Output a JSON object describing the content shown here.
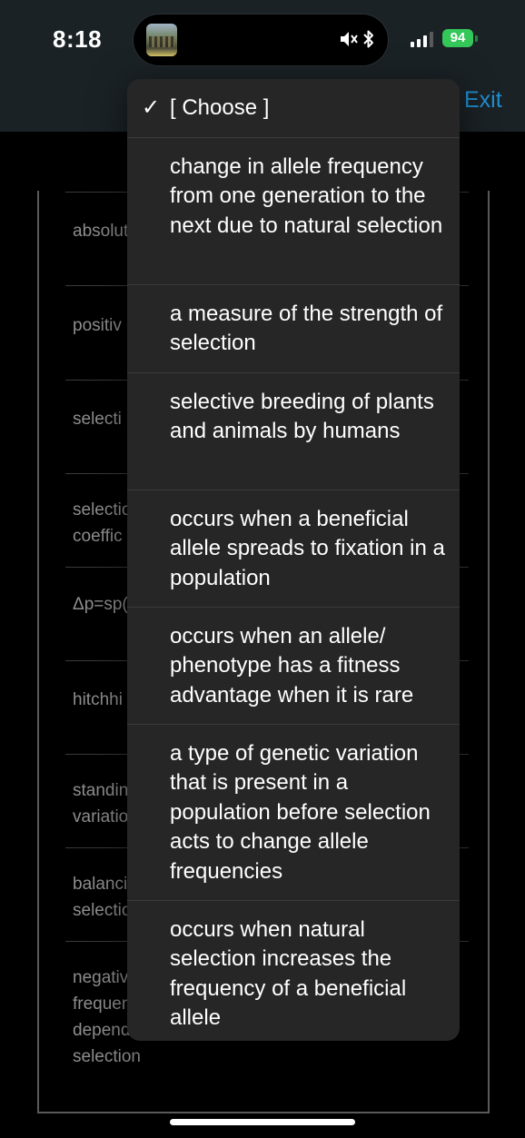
{
  "status_bar": {
    "time": "8:18",
    "battery": "94"
  },
  "header": {
    "exit_label": "Exit"
  },
  "terms": [
    {
      "label": "absolut"
    },
    {
      "label": "positiv"
    },
    {
      "label": "selecti"
    },
    {
      "label": "selectio coeffic"
    },
    {
      "label": "Δp=sp("
    },
    {
      "label": "hitchhi"
    },
    {
      "label": "standin variatio"
    },
    {
      "label": "balanci selectio"
    },
    {
      "label": "negativ frequen depende selection"
    }
  ],
  "dropdown": {
    "selected_mark": "✓",
    "options": [
      {
        "text": "[ Choose ]"
      },
      {
        "text": "change in allele frequency from one generation to the next due to natural selection"
      },
      {
        "text": "a measure of the strength of selection"
      },
      {
        "text": "selective breeding of plants and animals by humans"
      },
      {
        "text": "occurs when a beneficial allele spreads to fixation in a population"
      },
      {
        "text": "occurs when an allele/ phenotype has a fitness advantage when it is rare"
      },
      {
        "text": "a type of genetic variation that is present in a population before selection acts to change allele frequencies"
      },
      {
        "text": "occurs when natural selection increases the frequency of a beneficial allele"
      }
    ]
  },
  "colors": {
    "accent": "#1f8fd1",
    "battery": "#34c759",
    "popup_bg": "#262626",
    "header_bg": "#1b2226"
  }
}
